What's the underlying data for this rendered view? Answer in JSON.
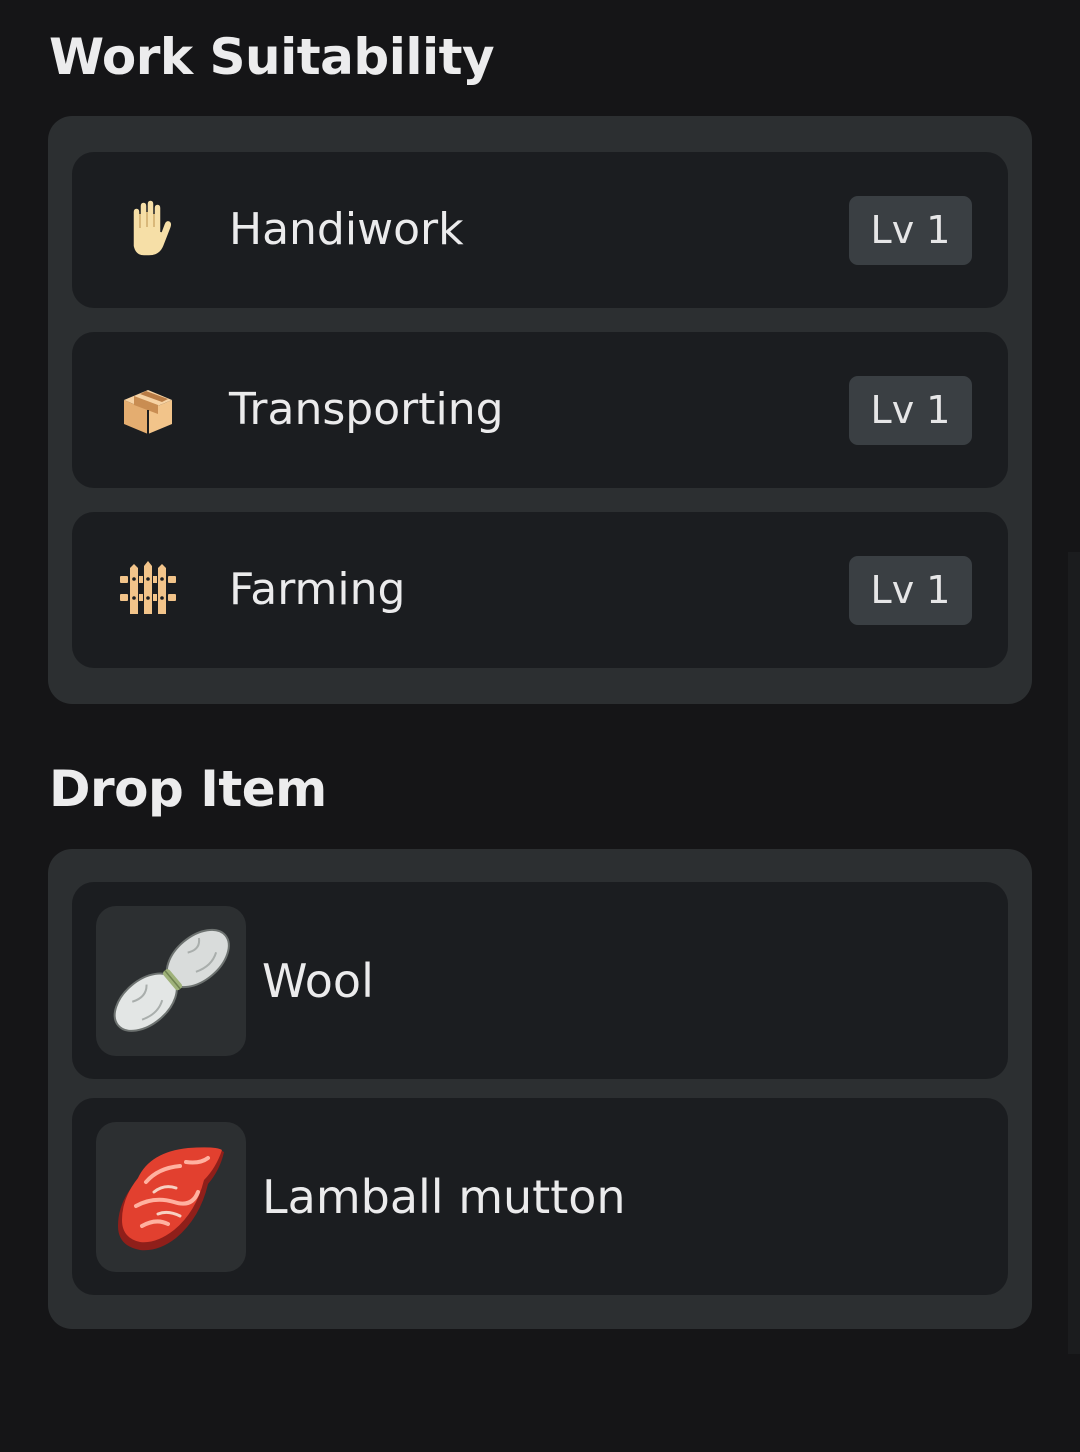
{
  "work_suitability": {
    "title": "Work Suitability",
    "items": [
      {
        "icon": "hand-icon",
        "label": "Handiwork",
        "level": "Lv 1"
      },
      {
        "icon": "box-icon",
        "label": "Transporting",
        "level": "Lv 1"
      },
      {
        "icon": "fence-icon",
        "label": "Farming",
        "level": "Lv 1"
      }
    ]
  },
  "drop_item": {
    "title": "Drop Item",
    "items": [
      {
        "icon": "wool-icon",
        "label": "Wool"
      },
      {
        "icon": "mutton-icon",
        "label": "Lamball mutton"
      }
    ]
  },
  "colors": {
    "background": "#151517",
    "panel": "#2c2f31",
    "row": "#1b1d20",
    "badge": "#3a3f43",
    "icon_accent": "#f2c48a"
  }
}
